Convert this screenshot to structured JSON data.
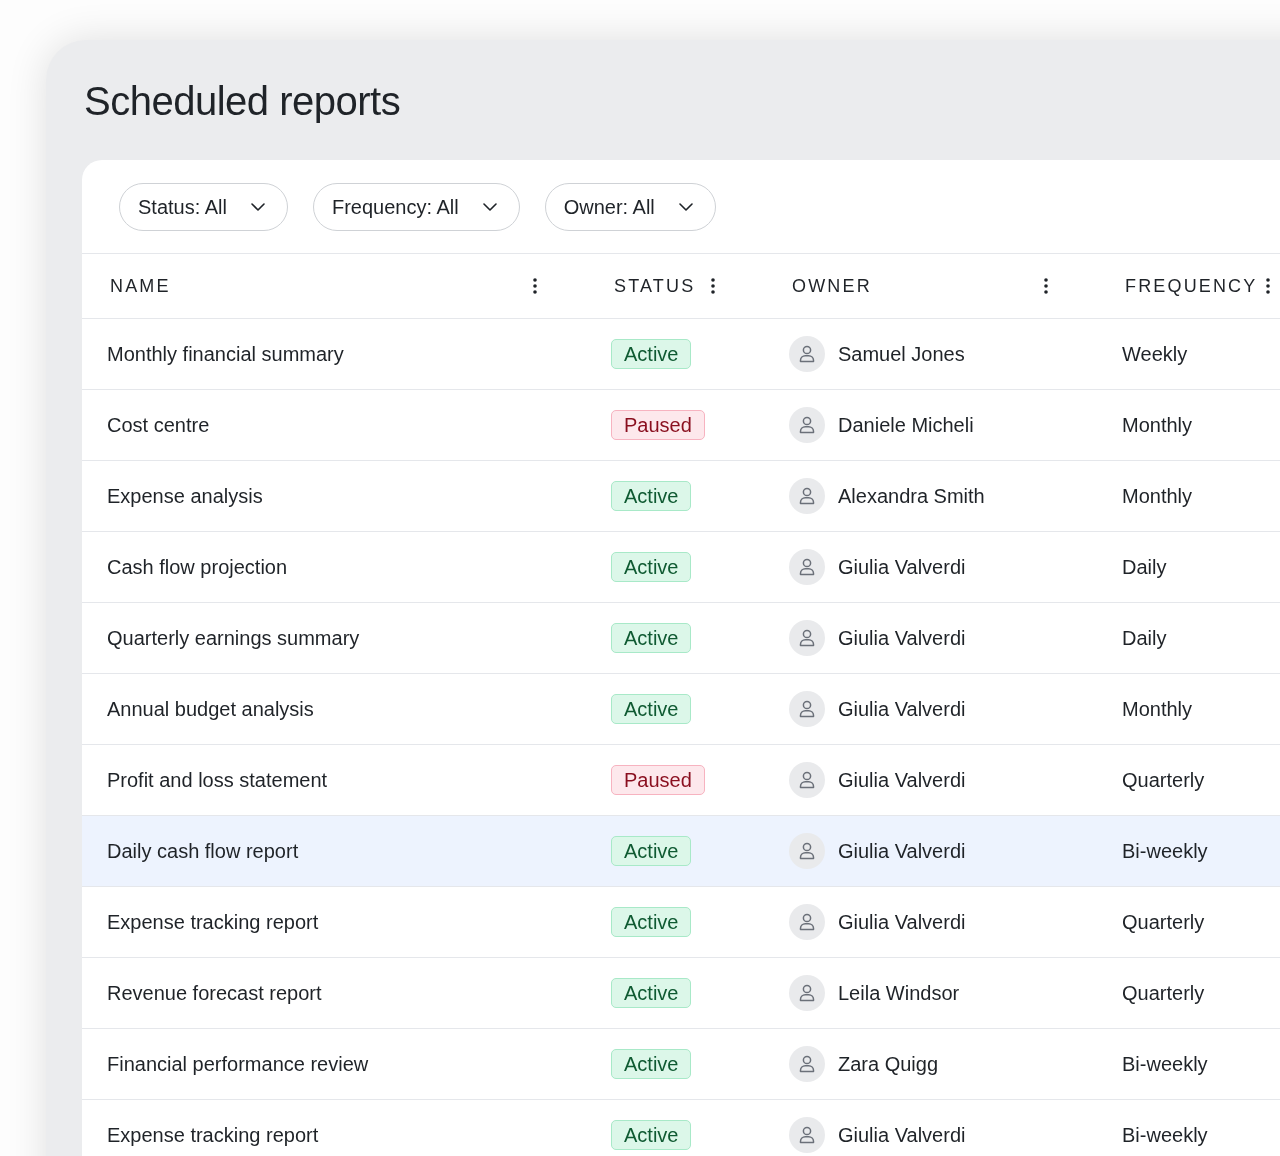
{
  "title": "Scheduled reports",
  "filters": [
    {
      "label": "Status: All"
    },
    {
      "label": "Frequency: All"
    },
    {
      "label": "Owner: All"
    }
  ],
  "table": {
    "columns": [
      "NAME",
      "STATUS",
      "OWNER",
      "FREQUENCY"
    ],
    "rows": [
      {
        "name": "Monthly financial summary",
        "status": {
          "label": "Active",
          "kind": "active"
        },
        "owner": "Samuel Jones",
        "frequency": "Weekly",
        "selected": false
      },
      {
        "name": "Cost centre",
        "status": {
          "label": "Paused",
          "kind": "paused"
        },
        "owner": "Daniele Micheli",
        "frequency": "Monthly",
        "selected": false
      },
      {
        "name": "Expense analysis",
        "status": {
          "label": "Active",
          "kind": "active"
        },
        "owner": "Alexandra Smith",
        "frequency": "Monthly",
        "selected": false
      },
      {
        "name": "Cash flow projection",
        "status": {
          "label": "Active",
          "kind": "active"
        },
        "owner": "Giulia Valverdi",
        "frequency": "Daily",
        "selected": false
      },
      {
        "name": "Quarterly earnings summary",
        "status": {
          "label": "Active",
          "kind": "active"
        },
        "owner": "Giulia Valverdi",
        "frequency": "Daily",
        "selected": false
      },
      {
        "name": "Annual budget analysis",
        "status": {
          "label": "Active",
          "kind": "active"
        },
        "owner": "Giulia Valverdi",
        "frequency": "Monthly",
        "selected": false
      },
      {
        "name": "Profit and loss statement",
        "status": {
          "label": "Paused",
          "kind": "paused"
        },
        "owner": "Giulia Valverdi",
        "frequency": "Quarterly",
        "selected": false
      },
      {
        "name": "Daily cash flow report",
        "status": {
          "label": "Active",
          "kind": "active"
        },
        "owner": "Giulia Valverdi",
        "frequency": "Bi-weekly",
        "selected": true
      },
      {
        "name": "Expense tracking report",
        "status": {
          "label": "Active",
          "kind": "active"
        },
        "owner": "Giulia Valverdi",
        "frequency": "Quarterly",
        "selected": false
      },
      {
        "name": "Revenue forecast report",
        "status": {
          "label": "Active",
          "kind": "active"
        },
        "owner": "Leila Windsor",
        "frequency": "Quarterly",
        "selected": false
      },
      {
        "name": "Financial performance review",
        "status": {
          "label": "Active",
          "kind": "active"
        },
        "owner": "Zara Quigg",
        "frequency": "Bi-weekly",
        "selected": false
      },
      {
        "name": "Expense tracking report",
        "status": {
          "label": "Active",
          "kind": "active"
        },
        "owner": "Giulia Valverdi",
        "frequency": "Bi-weekly",
        "selected": false
      }
    ]
  }
}
